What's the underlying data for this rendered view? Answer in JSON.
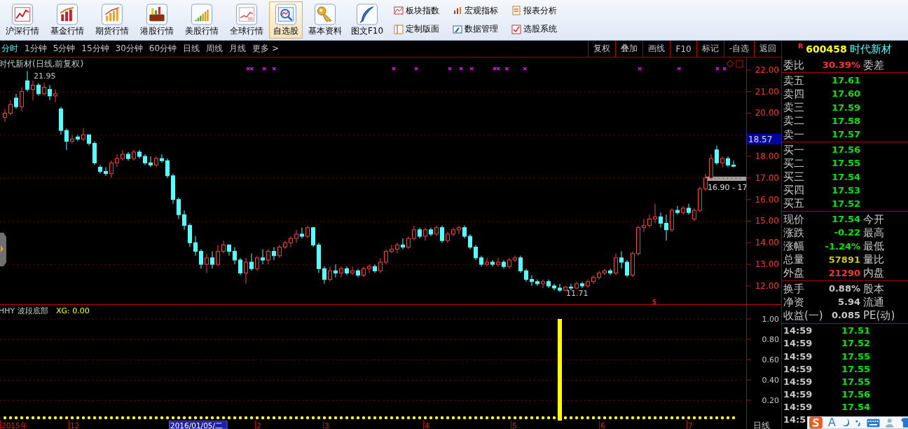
{
  "toolbar": {
    "buttons": [
      {
        "label": "沪深行情",
        "selected": false
      },
      {
        "label": "基金行情",
        "selected": false
      },
      {
        "label": "期货行情",
        "selected": false
      },
      {
        "label": "港股行情",
        "selected": false
      },
      {
        "label": "美股行情",
        "selected": false
      },
      {
        "label": "全球行情",
        "selected": false
      },
      {
        "label": "自选股",
        "selected": true
      },
      {
        "label": "基本资料",
        "selected": false
      },
      {
        "label": "图文F10",
        "selected": false
      }
    ],
    "links": [
      "板块指数",
      "宏观指标",
      "报表分析",
      "定制版面",
      "数据管理",
      "选股系统"
    ]
  },
  "periods": [
    {
      "label": "分时",
      "selected": true
    },
    {
      "label": "1分钟",
      "selected": false
    },
    {
      "label": "5分钟",
      "selected": false
    },
    {
      "label": "15分钟",
      "selected": false
    },
    {
      "label": "30分钟",
      "selected": false
    },
    {
      "label": "60分钟",
      "selected": false
    },
    {
      "label": "日线",
      "selected": false
    },
    {
      "label": "周线",
      "selected": false
    },
    {
      "label": "月线",
      "selected": false
    },
    {
      "label": "更多 >",
      "selected": false
    }
  ],
  "chart_tools": [
    "复权",
    "叠加",
    "画线",
    "F10",
    "标记",
    "-自选",
    "返回"
  ],
  "stock_header": {
    "badge": "R",
    "code": "600458",
    "name": "时代新材"
  },
  "main_chart": {
    "title": "时代新材(日线,前复权)",
    "high_label": "21.95",
    "low_label": "11.71",
    "current_price": "18.57",
    "range_label": "16.90 - 17",
    "signal_mark": "$",
    "chart_data": {
      "type": "candlestick",
      "ylim": [
        11.12,
        22.58
      ],
      "grid": true,
      "yticks": [
        {
          "value": 22,
          "label": "22.00"
        },
        {
          "value": 21,
          "label": "21.00"
        },
        {
          "value": 20,
          "label": "20.00"
        },
        {
          "value": 18,
          "label": "18.00"
        },
        {
          "value": 17,
          "label": "17.00"
        },
        {
          "value": 16,
          "label": "16.00"
        },
        {
          "value": 15,
          "label": "15.00"
        },
        {
          "value": 14,
          "label": "14.00"
        },
        {
          "value": 13,
          "label": "13.00"
        },
        {
          "value": 12,
          "label": "12.00"
        }
      ],
      "ohlc": [
        [
          19.8,
          20.2,
          19.6,
          20.0
        ],
        [
          20.0,
          20.6,
          19.9,
          20.4
        ],
        [
          20.7,
          20.9,
          20.2,
          20.3
        ],
        [
          20.3,
          21.2,
          20.1,
          21.0
        ],
        [
          21.5,
          21.95,
          21.0,
          21.1
        ],
        [
          21.1,
          21.5,
          20.6,
          21.3
        ],
        [
          21.3,
          21.4,
          20.8,
          20.9
        ],
        [
          20.9,
          21.4,
          20.8,
          21.2
        ],
        [
          21.1,
          21.3,
          20.6,
          20.8
        ],
        [
          20.8,
          21.1,
          20.5,
          20.9
        ],
        [
          20.2,
          20.3,
          19.0,
          19.2
        ],
        [
          19.2,
          19.3,
          18.3,
          18.7
        ],
        [
          18.7,
          19.0,
          18.6,
          18.8
        ],
        [
          18.9,
          19.0,
          18.7,
          18.8
        ],
        [
          18.8,
          19.3,
          18.7,
          19.0
        ],
        [
          19.0,
          19.0,
          18.5,
          18.6
        ],
        [
          18.6,
          18.7,
          17.6,
          17.7
        ],
        [
          17.5,
          17.6,
          17.2,
          17.3
        ],
        [
          17.3,
          17.5,
          17.1,
          17.2
        ],
        [
          17.2,
          17.8,
          17.0,
          17.7
        ],
        [
          17.7,
          18.1,
          17.5,
          17.9
        ],
        [
          17.9,
          18.3,
          17.8,
          18.1
        ],
        [
          18.1,
          18.2,
          17.8,
          17.9
        ],
        [
          17.9,
          18.3,
          17.8,
          18.2
        ],
        [
          18.2,
          18.3,
          17.9,
          18.0
        ],
        [
          18.0,
          18.1,
          17.6,
          17.7
        ],
        [
          17.7,
          18.0,
          17.5,
          17.6
        ],
        [
          17.6,
          18.0,
          17.5,
          17.9
        ],
        [
          17.9,
          18.1,
          17.7,
          17.8
        ],
        [
          17.8,
          17.9,
          17.0,
          17.1
        ],
        [
          17.1,
          17.2,
          15.8,
          16.0
        ],
        [
          16.0,
          16.1,
          15.1,
          15.3
        ],
        [
          15.3,
          15.5,
          14.6,
          14.8
        ],
        [
          14.8,
          14.9,
          13.8,
          14.0
        ],
        [
          14.0,
          14.3,
          13.4,
          13.6
        ],
        [
          13.6,
          13.7,
          12.8,
          13.0
        ],
        [
          13.0,
          13.5,
          12.6,
          13.3
        ],
        [
          13.3,
          13.6,
          12.8,
          13.0
        ],
        [
          13.0,
          13.9,
          12.9,
          13.6
        ],
        [
          13.6,
          14.1,
          13.5,
          13.9
        ],
        [
          13.9,
          13.9,
          13.4,
          13.6
        ],
        [
          13.6,
          13.8,
          13.0,
          13.2
        ],
        [
          13.2,
          13.3,
          12.5,
          12.6
        ],
        [
          12.6,
          13.3,
          12.1,
          13.1
        ],
        [
          13.1,
          13.5,
          12.7,
          12.8
        ],
        [
          12.8,
          13.4,
          12.7,
          13.3
        ],
        [
          13.3,
          13.7,
          13.0,
          13.2
        ],
        [
          13.2,
          13.7,
          13.0,
          13.6
        ],
        [
          13.6,
          13.8,
          13.2,
          13.4
        ],
        [
          13.4,
          13.9,
          13.3,
          13.8
        ],
        [
          13.8,
          14.1,
          13.7,
          14.0
        ],
        [
          14.0,
          14.3,
          13.8,
          14.2
        ],
        [
          14.2,
          14.6,
          14.0,
          14.4
        ],
        [
          14.4,
          14.7,
          14.2,
          14.3
        ],
        [
          14.3,
          14.8,
          14.2,
          14.7
        ],
        [
          14.7,
          14.7,
          13.8,
          13.9
        ],
        [
          13.9,
          14.0,
          12.6,
          12.8
        ],
        [
          12.8,
          12.9,
          12.1,
          12.3
        ],
        [
          12.3,
          12.9,
          12.2,
          12.7
        ],
        [
          12.7,
          13.0,
          12.4,
          12.6
        ],
        [
          12.6,
          12.9,
          12.4,
          12.8
        ],
        [
          12.8,
          12.9,
          12.5,
          12.6
        ],
        [
          12.6,
          12.9,
          12.5,
          12.7
        ],
        [
          12.7,
          12.8,
          12.4,
          12.5
        ],
        [
          12.5,
          12.9,
          12.4,
          12.8
        ],
        [
          12.8,
          13.0,
          12.6,
          12.9
        ],
        [
          12.9,
          13.0,
          12.6,
          12.7
        ],
        [
          12.7,
          13.3,
          12.6,
          13.1
        ],
        [
          13.1,
          13.7,
          13.0,
          13.6
        ],
        [
          13.6,
          13.9,
          13.5,
          13.7
        ],
        [
          13.7,
          14.0,
          13.5,
          13.9
        ],
        [
          13.9,
          14.2,
          13.7,
          13.8
        ],
        [
          13.8,
          14.3,
          13.7,
          14.2
        ],
        [
          14.2,
          14.8,
          14.1,
          14.6
        ],
        [
          14.6,
          14.7,
          14.2,
          14.3
        ],
        [
          14.3,
          14.7,
          14.1,
          14.6
        ],
        [
          14.6,
          14.7,
          14.3,
          14.4
        ],
        [
          14.4,
          14.8,
          14.3,
          14.7
        ],
        [
          14.7,
          14.8,
          14.0,
          14.1
        ],
        [
          14.1,
          14.5,
          14.0,
          14.4
        ],
        [
          14.4,
          14.7,
          14.3,
          14.6
        ],
        [
          14.6,
          14.8,
          14.4,
          14.7
        ],
        [
          14.7,
          14.8,
          14.2,
          14.3
        ],
        [
          14.3,
          14.4,
          13.7,
          13.8
        ],
        [
          13.8,
          13.9,
          13.2,
          13.3
        ],
        [
          13.3,
          13.4,
          12.9,
          13.0
        ],
        [
          13.0,
          13.3,
          12.9,
          13.1
        ],
        [
          13.1,
          13.2,
          12.9,
          13.0
        ],
        [
          13.0,
          13.3,
          12.9,
          13.1
        ],
        [
          13.1,
          13.2,
          12.8,
          12.9
        ],
        [
          12.9,
          13.3,
          12.8,
          13.2
        ],
        [
          13.2,
          13.4,
          13.1,
          13.3
        ],
        [
          13.3,
          13.4,
          12.6,
          12.7
        ],
        [
          12.7,
          12.8,
          12.2,
          12.3
        ],
        [
          12.3,
          12.5,
          12.0,
          12.2
        ],
        [
          12.2,
          12.3,
          12.0,
          12.1
        ],
        [
          12.1,
          12.3,
          11.9,
          12.2
        ],
        [
          12.2,
          12.3,
          11.9,
          12.0
        ],
        [
          12.0,
          12.1,
          11.8,
          11.9
        ],
        [
          11.9,
          12.1,
          11.71,
          11.8
        ],
        [
          11.8,
          12.0,
          11.75,
          11.95
        ],
        [
          11.95,
          12.1,
          11.8,
          11.9
        ],
        [
          11.9,
          12.2,
          11.85,
          12.1
        ],
        [
          12.1,
          12.2,
          11.9,
          12.0
        ],
        [
          12.0,
          12.3,
          11.9,
          12.2
        ],
        [
          12.2,
          12.5,
          12.1,
          12.4
        ],
        [
          12.4,
          12.7,
          12.3,
          12.6
        ],
        [
          12.6,
          12.8,
          12.5,
          12.7
        ],
        [
          12.7,
          12.8,
          12.5,
          12.6
        ],
        [
          12.6,
          13.5,
          12.5,
          13.3
        ],
        [
          13.3,
          13.6,
          12.8,
          13.1
        ],
        [
          13.1,
          13.2,
          12.4,
          12.5
        ],
        [
          12.5,
          13.6,
          12.4,
          13.5
        ],
        [
          13.5,
          14.8,
          13.4,
          14.7
        ],
        [
          14.7,
          15.1,
          14.5,
          14.8
        ],
        [
          14.8,
          15.3,
          14.7,
          15.1
        ],
        [
          15.1,
          15.8,
          14.9,
          15.2
        ],
        [
          15.2,
          15.4,
          14.7,
          14.9
        ],
        [
          14.9,
          15.3,
          14.1,
          14.6
        ],
        [
          14.6,
          15.6,
          14.5,
          15.5
        ],
        [
          15.5,
          15.7,
          15.3,
          15.4
        ],
        [
          15.4,
          15.7,
          15.3,
          15.6
        ],
        [
          15.6,
          15.8,
          15.3,
          15.4
        ],
        [
          15.1,
          15.6,
          15.0,
          15.5
        ],
        [
          15.5,
          16.6,
          15.4,
          16.5
        ],
        [
          16.5,
          17.2,
          16.4,
          17.0
        ],
        [
          17.0,
          18.1,
          16.9,
          17.9
        ],
        [
          18.3,
          18.5,
          17.6,
          17.7
        ],
        [
          17.7,
          18.0,
          17.5,
          17.9
        ],
        [
          17.9,
          18.0,
          17.5,
          17.6
        ],
        [
          17.6,
          17.8,
          17.5,
          17.54
        ]
      ]
    }
  },
  "indicator": {
    "name": "HHY 波段底部",
    "value": "XG: 0.00",
    "chart_data": {
      "type": "bar",
      "ylim": [
        0,
        1.138
      ],
      "grid": true,
      "yticks": [
        {
          "value": 1,
          "label": "1.00"
        },
        {
          "value": 0.8,
          "label": "0.80"
        },
        {
          "value": 0.6,
          "label": "0.60"
        },
        {
          "value": 0.4,
          "label": "0.40"
        },
        {
          "value": 0.2,
          "label": "0.20"
        }
      ],
      "values": [
        0,
        0,
        0,
        0,
        0,
        0,
        0,
        0,
        0,
        0,
        0,
        0,
        0,
        0,
        0,
        0,
        0,
        0,
        0,
        0,
        0,
        0,
        0,
        0,
        0,
        0,
        0,
        0,
        0,
        0,
        0,
        0,
        0,
        0,
        0,
        0,
        0,
        0,
        0,
        0,
        0,
        0,
        0,
        0,
        0,
        0,
        0,
        0,
        0,
        0,
        0,
        0,
        0,
        0,
        0,
        0,
        0,
        0,
        0,
        0,
        0,
        0,
        0,
        0,
        0,
        0,
        0,
        0,
        0,
        0,
        0,
        0,
        0,
        0,
        0,
        0,
        0,
        0,
        0,
        0,
        0,
        0,
        0,
        0,
        0,
        0,
        0,
        0,
        0,
        0,
        0,
        0,
        0,
        0,
        0,
        0,
        0,
        0,
        0,
        1,
        0,
        0,
        0,
        0,
        0,
        0,
        0,
        0,
        0,
        0,
        0,
        0,
        0,
        0,
        0,
        0,
        0,
        0,
        0,
        0,
        0,
        0,
        0,
        0,
        0,
        0,
        0,
        0,
        0,
        0,
        0
      ]
    }
  },
  "date_axis": {
    "labels": [
      {
        "label": "2015年",
        "selected": false
      },
      {
        "label": "12",
        "selected": false
      },
      {
        "label": "2016/01/05/二",
        "selected": true
      },
      {
        "label": "2",
        "selected": false
      },
      {
        "label": "3",
        "selected": false
      },
      {
        "label": "4",
        "selected": false
      },
      {
        "label": "5",
        "selected": false
      },
      {
        "label": "6",
        "selected": false
      },
      {
        "label": "7",
        "selected": false
      }
    ],
    "period": "日线"
  },
  "quote": {
    "ratio": {
      "label": "委比",
      "value": "30.39%",
      "label2": "委差"
    },
    "asks": [
      {
        "label": "卖五",
        "price": "17.61"
      },
      {
        "label": "卖四",
        "price": "17.60"
      },
      {
        "label": "卖三",
        "price": "17.59"
      },
      {
        "label": "卖二",
        "price": "17.58"
      },
      {
        "label": "卖一",
        "price": "17.57"
      }
    ],
    "bids": [
      {
        "label": "买一",
        "price": "17.56"
      },
      {
        "label": "买二",
        "price": "17.55"
      },
      {
        "label": "买三",
        "price": "17.54"
      },
      {
        "label": "买四",
        "price": "17.53"
      },
      {
        "label": "买五",
        "price": "17.52"
      }
    ],
    "stats": [
      {
        "label": "现价",
        "value": "17.54",
        "label2": "今开",
        "color": "#00e600"
      },
      {
        "label": "涨跌",
        "value": "-0.22",
        "label2": "最高",
        "color": "#00e600"
      },
      {
        "label": "涨幅",
        "value": "-1.24%",
        "label2": "最低",
        "color": "#00e600"
      },
      {
        "label": "总量",
        "value": "57891",
        "label2": "量比",
        "color": "#c8c800"
      },
      {
        "label": "外盘",
        "value": "21290",
        "label2": "内盘",
        "color": "#ff3232"
      }
    ],
    "fundamentals": [
      {
        "label": "换手",
        "value": "0.88%",
        "label2": "股本"
      },
      {
        "label": "净资",
        "value": "5.94",
        "label2": "流通"
      },
      {
        "label": "收益(一)",
        "value": "0.085",
        "label2": "PE(动)"
      }
    ],
    "trades": [
      {
        "time": "14:59",
        "price": "17.51"
      },
      {
        "time": "14:59",
        "price": "17.52"
      },
      {
        "time": "14:59",
        "price": "17.55"
      },
      {
        "time": "14:59",
        "price": "17.55"
      },
      {
        "time": "14:59",
        "price": "17.55"
      },
      {
        "time": "14:59",
        "price": "17.56"
      },
      {
        "time": "14:59",
        "price": "17.54"
      },
      {
        "time": "14:5"
      }
    ]
  },
  "ime_bar": {
    "mode": "A"
  }
}
